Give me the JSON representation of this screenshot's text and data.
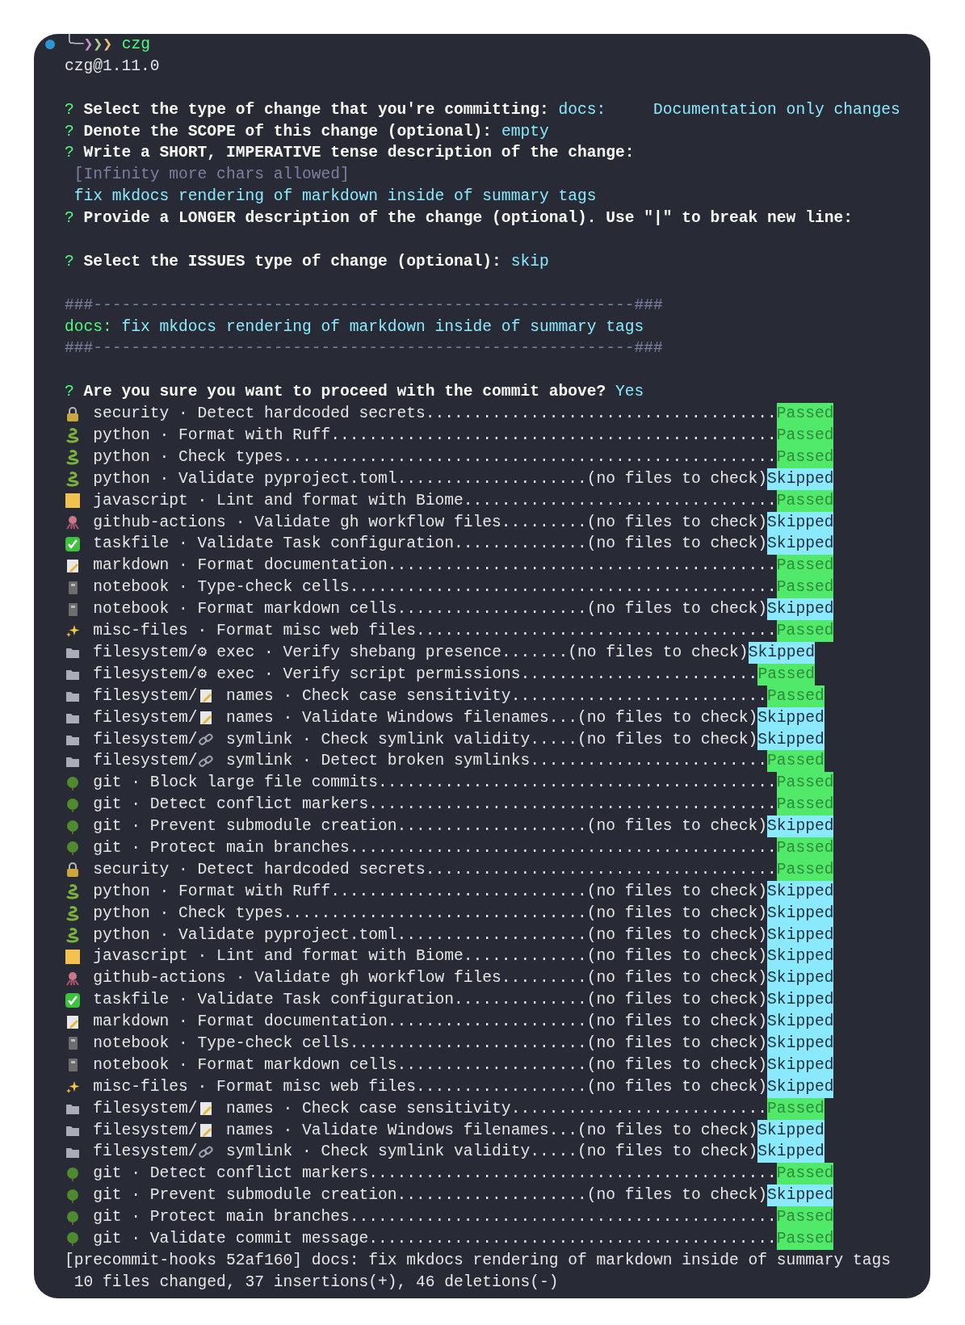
{
  "terminal": {
    "lines": [
      {
        "kind": "prompt",
        "connector": "╰─",
        "arrows": [
          {
            "char": "❯",
            "color": "#c792c8"
          },
          {
            "char": "❯",
            "color": "#b5c98a"
          },
          {
            "char": "❯",
            "color": "#e6c07b"
          }
        ],
        "command": "czg"
      },
      {
        "kind": "text",
        "text": "czg@1.11.0"
      },
      {
        "kind": "blank"
      },
      {
        "kind": "question",
        "mark": "?",
        "label": "Select the type of change that you're committing:",
        "answer": "docs:     Documentation only changes"
      },
      {
        "kind": "question",
        "mark": "?",
        "label": "Denote the SCOPE of this change (optional):",
        "answer": "empty"
      },
      {
        "kind": "question",
        "mark": "?",
        "label": "Write a SHORT, IMPERATIVE tense description of the change:"
      },
      {
        "kind": "hint",
        "text": "[Infinity more chars allowed]"
      },
      {
        "kind": "input",
        "text": "fix mkdocs rendering of markdown inside of summary tags"
      },
      {
        "kind": "question",
        "mark": "?",
        "label": "Provide a LONGER description of the change (optional). Use \"|\" to break new line:"
      },
      {
        "kind": "blank"
      },
      {
        "kind": "question",
        "mark": "?",
        "label": "Select the ISSUES type of change (optional):",
        "answer": "skip"
      },
      {
        "kind": "blank"
      },
      {
        "kind": "rule",
        "text": "###---------------------------------------------------------###"
      },
      {
        "kind": "commit",
        "type": "docs:",
        "subject": "fix mkdocs rendering of markdown inside of summary tags"
      },
      {
        "kind": "rule",
        "text": "###---------------------------------------------------------###"
      },
      {
        "kind": "blank"
      },
      {
        "kind": "question",
        "mark": "?",
        "label": "Are you sure you want to proceed with the commit above?",
        "answer": "Yes"
      }
    ],
    "hooks": [
      {
        "kind": "lock",
        "text": "security · Detect hardcoded secrets.....................................",
        "status": {
          "kind": "passed",
          "text": "Passed"
        }
      },
      {
        "kind": "snake",
        "text": "python · Format with Ruff...............................................",
        "status": {
          "kind": "passed",
          "text": "Passed"
        }
      },
      {
        "kind": "snake",
        "text": "python · Check types....................................................",
        "status": {
          "kind": "passed",
          "text": "Passed"
        }
      },
      {
        "kind": "snake",
        "text": "python · Validate pyproject.toml....................(no files to check)",
        "status": {
          "kind": "skipped",
          "text": "Skipped"
        }
      },
      {
        "kind": "square",
        "text": "javascript · Lint and format with Biome.................................",
        "status": {
          "kind": "passed",
          "text": "Passed"
        }
      },
      {
        "kind": "octopus",
        "text": "github-actions · Validate gh workflow files.........(no files to check)",
        "status": {
          "kind": "skipped",
          "text": "Skipped"
        }
      },
      {
        "kind": "check",
        "text": "taskfile · Validate Task configuration..............(no files to check)",
        "status": {
          "kind": "skipped",
          "text": "Skipped"
        }
      },
      {
        "kind": "memo",
        "text": "markdown · Format documentation.........................................",
        "status": {
          "kind": "passed",
          "text": "Passed"
        }
      },
      {
        "kind": "notebook",
        "text": "notebook · Type-check cells.............................................",
        "status": {
          "kind": "passed",
          "text": "Passed"
        }
      },
      {
        "kind": "notebook",
        "text": "notebook · Format markdown cells....................(no files to check)",
        "status": {
          "kind": "skipped",
          "text": "Skipped"
        }
      },
      {
        "kind": "sparkles",
        "text": "misc-files · Format misc web files......................................",
        "status": {
          "kind": "passed",
          "text": "Passed"
        }
      },
      {
        "kind": "folder",
        "text": "filesystem/⚙ exec · Verify shebang presence.......(no files to check)",
        "status": {
          "kind": "skipped",
          "text": "Skipped"
        }
      },
      {
        "kind": "folder",
        "text": "filesystem/⚙ exec · Verify script permissions.........................",
        "status": {
          "kind": "passed",
          "text": "Passed"
        }
      },
      {
        "kind": "folder",
        "scope": {
          "kind": "memo",
          "text": "filesystem/"
        },
        "text": " names · Check case sensitivity...........................",
        "status": {
          "kind": "passed",
          "text": "Passed"
        }
      },
      {
        "kind": "folder",
        "scope": {
          "kind": "memo",
          "text": "filesystem/"
        },
        "text": " names · Validate Windows filenames...(no files to check)",
        "status": {
          "kind": "skipped",
          "text": "Skipped"
        }
      },
      {
        "kind": "folder",
        "scope": {
          "kind": "link",
          "text": "filesystem/"
        },
        "text": " symlink · Check symlink validity.....(no files to check)",
        "status": {
          "kind": "skipped",
          "text": "Skipped"
        }
      },
      {
        "kind": "folder",
        "scope": {
          "kind": "link",
          "text": "filesystem/"
        },
        "text": " symlink · Detect broken symlinks.........................",
        "status": {
          "kind": "passed",
          "text": "Passed"
        }
      },
      {
        "kind": "tree",
        "text": "git · Block large file commits..........................................",
        "status": {
          "kind": "passed",
          "text": "Passed"
        }
      },
      {
        "kind": "tree",
        "text": "git · Detect conflict markers...........................................",
        "status": {
          "kind": "passed",
          "text": "Passed"
        }
      },
      {
        "kind": "tree",
        "text": "git · Prevent submodule creation....................(no files to check)",
        "status": {
          "kind": "skipped",
          "text": "Skipped"
        }
      },
      {
        "kind": "tree",
        "text": "git · Protect main branches.............................................",
        "status": {
          "kind": "passed",
          "text": "Passed"
        }
      },
      {
        "kind": "lock",
        "text": "security · Detect hardcoded secrets.....................................",
        "status": {
          "kind": "passed",
          "text": "Passed"
        }
      },
      {
        "kind": "snake",
        "text": "python · Format with Ruff...........................(no files to check)",
        "status": {
          "kind": "skipped",
          "text": "Skipped"
        }
      },
      {
        "kind": "snake",
        "text": "python · Check types................................(no files to check)",
        "status": {
          "kind": "skipped",
          "text": "Skipped"
        }
      },
      {
        "kind": "snake",
        "text": "python · Validate pyproject.toml....................(no files to check)",
        "status": {
          "kind": "skipped",
          "text": "Skipped"
        }
      },
      {
        "kind": "square",
        "text": "javascript · Lint and format with Biome.............(no files to check)",
        "status": {
          "kind": "skipped",
          "text": "Skipped"
        }
      },
      {
        "kind": "octopus",
        "text": "github-actions · Validate gh workflow files.........(no files to check)",
        "status": {
          "kind": "skipped",
          "text": "Skipped"
        }
      },
      {
        "kind": "check",
        "text": "taskfile · Validate Task configuration..............(no files to check)",
        "status": {
          "kind": "skipped",
          "text": "Skipped"
        }
      },
      {
        "kind": "memo",
        "text": "markdown · Format documentation.....................(no files to check)",
        "status": {
          "kind": "skipped",
          "text": "Skipped"
        }
      },
      {
        "kind": "notebook",
        "text": "notebook · Type-check cells.........................(no files to check)",
        "status": {
          "kind": "skipped",
          "text": "Skipped"
        }
      },
      {
        "kind": "notebook",
        "text": "notebook · Format markdown cells....................(no files to check)",
        "status": {
          "kind": "skipped",
          "text": "Skipped"
        }
      },
      {
        "kind": "sparkles",
        "text": "misc-files · Format misc web files..................(no files to check)",
        "status": {
          "kind": "skipped",
          "text": "Skipped"
        }
      },
      {
        "kind": "folder",
        "scope": {
          "kind": "memo",
          "text": "filesystem/"
        },
        "text": " names · Check case sensitivity...........................",
        "status": {
          "kind": "passed",
          "text": "Passed"
        }
      },
      {
        "kind": "folder",
        "scope": {
          "kind": "memo",
          "text": "filesystem/"
        },
        "text": " names · Validate Windows filenames...(no files to check)",
        "status": {
          "kind": "skipped",
          "text": "Skipped"
        }
      },
      {
        "kind": "folder",
        "scope": {
          "kind": "link",
          "text": "filesystem/"
        },
        "text": " symlink · Check symlink validity.....(no files to check)",
        "status": {
          "kind": "skipped",
          "text": "Skipped"
        }
      },
      {
        "kind": "tree",
        "text": "git · Detect conflict markers...........................................",
        "status": {
          "kind": "passed",
          "text": "Passed"
        }
      },
      {
        "kind": "tree",
        "text": "git · Prevent submodule creation....................(no files to check)",
        "status": {
          "kind": "skipped",
          "text": "Skipped"
        }
      },
      {
        "kind": "tree",
        "text": "git · Protect main branches.............................................",
        "status": {
          "kind": "passed",
          "text": "Passed"
        }
      },
      {
        "kind": "tree",
        "text": "git · Validate commit message...........................................",
        "status": {
          "kind": "passed",
          "text": "Passed"
        }
      }
    ],
    "output": [
      {
        "kind": "commit-info",
        "text": "[precommit-hooks 52af160] docs: fix mkdocs rendering of markdown inside of summary tags"
      },
      {
        "kind": "stats",
        "text": "10 files changed, 37 insertions(+), 46 deletions(-)"
      }
    ]
  }
}
